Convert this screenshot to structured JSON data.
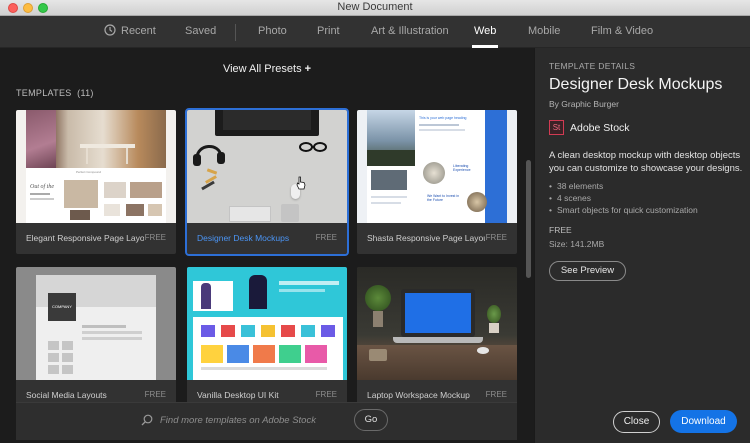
{
  "window": {
    "title": "New Document"
  },
  "tabs": [
    {
      "label": "Recent",
      "icon": "clock-icon",
      "active": false
    },
    {
      "label": "Saved",
      "active": false
    },
    {
      "label": "Photo",
      "active": false
    },
    {
      "label": "Print",
      "active": false
    },
    {
      "label": "Art & Illustration",
      "active": false
    },
    {
      "label": "Web",
      "active": true
    },
    {
      "label": "Mobile",
      "active": false
    },
    {
      "label": "Film & Video",
      "active": false
    }
  ],
  "presets": {
    "view_all_label": "View All Presets",
    "plus": "+"
  },
  "templates": {
    "heading": "TEMPLATES",
    "count": "(11)",
    "items": [
      {
        "name": "Elegant Responsive Page Layout",
        "price": "FREE",
        "selected": false
      },
      {
        "name": "Designer Desk Mockups",
        "price": "FREE",
        "selected": true
      },
      {
        "name": "Shasta Responsive Page Layout",
        "price": "FREE",
        "selected": false
      },
      {
        "name": "Social Media Layouts",
        "price": "FREE",
        "selected": false
      },
      {
        "name": "Vanilla Desktop UI Kit",
        "price": "FREE",
        "selected": false
      },
      {
        "name": "Laptop Workspace Mockup",
        "price": "FREE",
        "selected": false
      }
    ],
    "thumb_text": {
      "company": "COMPANY",
      "shasta_heading": "This is your web page heading",
      "shasta_liberating": "Liberating Experience",
      "shasta_invest": "We Want to Invest in the Future",
      "elegant_perfect": "Perfect Compound",
      "elegant_out": "Out of the"
    }
  },
  "search": {
    "placeholder": "Find more templates on Adobe Stock",
    "go_label": "Go"
  },
  "details": {
    "section_label": "TEMPLATE DETAILS",
    "title": "Designer Desk Mockups",
    "author": "By Graphic Burger",
    "stock_logo": "St",
    "stock_label": "Adobe Stock",
    "description": "A clean desktop mockup with desktop objects you can customize to showcase your designs.",
    "bullets": [
      "38 elements",
      "4 scenes",
      "Smart objects for quick customization"
    ],
    "price": "FREE",
    "size": "Size: 141.2MB",
    "preview_label": "See Preview",
    "close_label": "Close",
    "download_label": "Download"
  },
  "colors": {
    "accent": "#1473e6",
    "selected_outline": "#2d6fd6",
    "selected_caption": "#4b95f5",
    "stock_red": "#d23b53"
  }
}
